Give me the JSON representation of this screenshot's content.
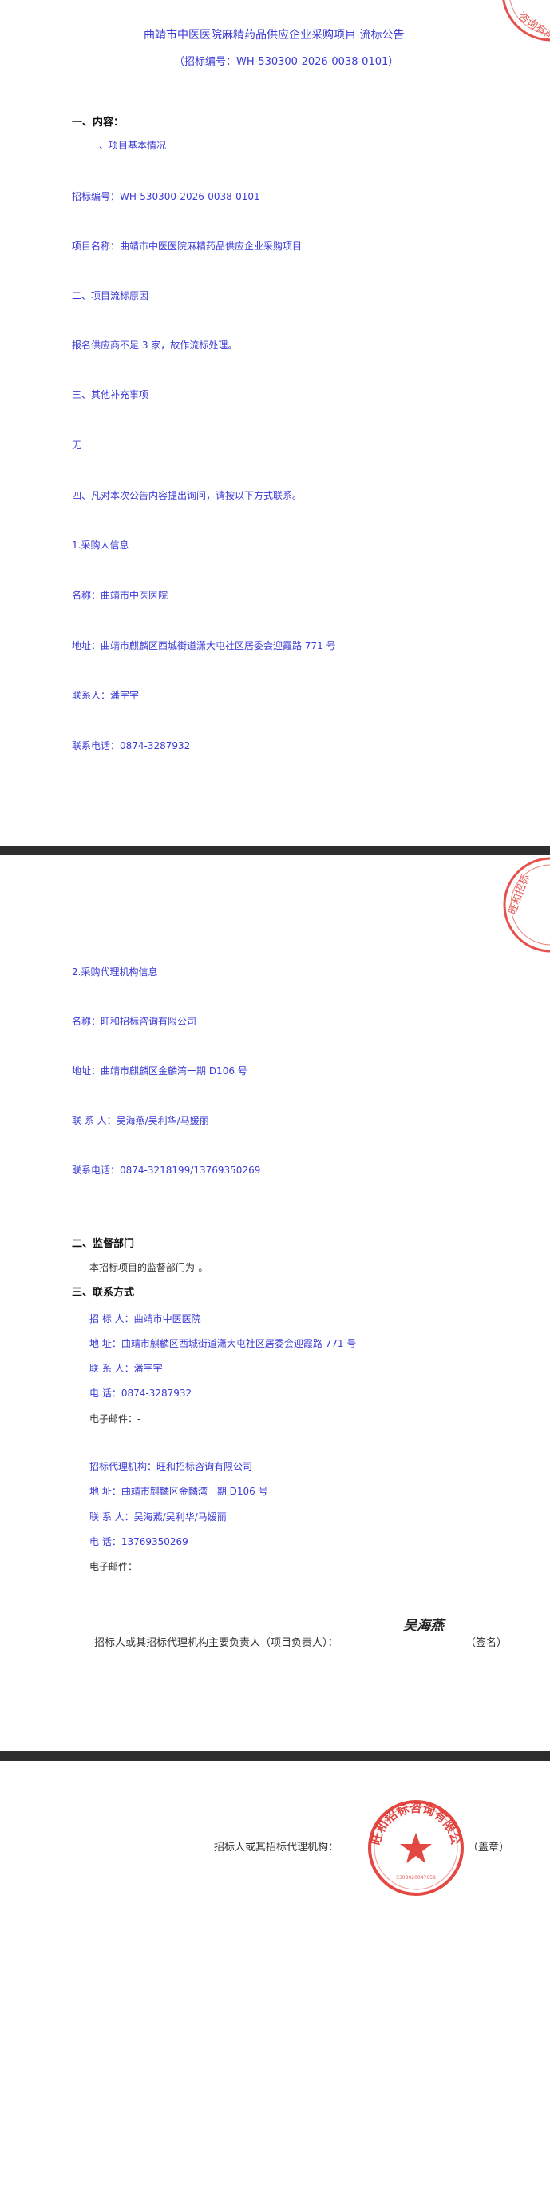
{
  "page1": {
    "title": "曲靖市中医医院麻精药品供应企业采购项目 流标公告",
    "subtitle": "（招标编号：WH-530300-2026-0038-0101）",
    "section1": "一、内容：",
    "item1": "一、项目基本情况",
    "bid_no": "招标编号：WH-530300-2026-0038-0101",
    "project_name": "项目名称：曲靖市中医医院麻精药品供应企业采购项目",
    "item2": "二、项目流标原因",
    "reason": "报名供应商不足 3 家，故作流标处理。",
    "item3": "三、其他补充事项",
    "none": "无",
    "item4": "四、凡对本次公告内容提出询问，请按以下方式联系。",
    "purchaser_head": "1.采购人信息",
    "purchaser_name": "名称：曲靖市中医医院",
    "purchaser_addr": "地址：曲靖市麒麟区西城街道潇大屯社区居委会迎霞路 771 号",
    "purchaser_contact": "联系人：潘宇宇",
    "purchaser_phone": "联系电话：0874-3287932"
  },
  "page2": {
    "agency_head": "2.采购代理机构信息",
    "agency_name": "名称：旺和招标咨询有限公司",
    "agency_addr": "地址：曲靖市麒麟区金麟湾一期 D106 号",
    "agency_contact": "联 系 人：吴海燕/吴利华/马媛丽",
    "agency_phone": "联系电话：0874-3218199/13769350269",
    "section2": "二、监督部门",
    "supervise": "本招标项目的监督部门为-。",
    "section3": "三、联系方式",
    "c_tenderer": "招  标  人：曲靖市中医医院",
    "c_addr1": "地      址：曲靖市麒麟区西城街道潇大屯社区居委会迎霞路 771 号",
    "c_contact1": "联  系  人：潘宇宇",
    "c_phone1": "电      话：0874-3287932",
    "c_email1": "电子邮件：-",
    "c_agency": "招标代理机构：旺和招标咨询有限公司",
    "c_addr2": "地      址：曲靖市麒麟区金麟湾一期 D106 号",
    "c_contact2": "联  系  人：吴海燕/吴利华/马媛丽",
    "c_phone2": "电      话：13769350269",
    "c_email2": "电子邮件：-",
    "sign_label": "招标人或其招标代理机构主要负责人（项目负责人）：",
    "sign_suffix": "（签名）",
    "signature": "吴海燕"
  },
  "page3": {
    "seal_label": "招标人或其招标代理机构：",
    "seal_suffix": "（盖章）"
  },
  "colors": {
    "link_blue": "#3b3bd6",
    "seal_red": "#e0342f",
    "separator": "#2e2e2e"
  }
}
